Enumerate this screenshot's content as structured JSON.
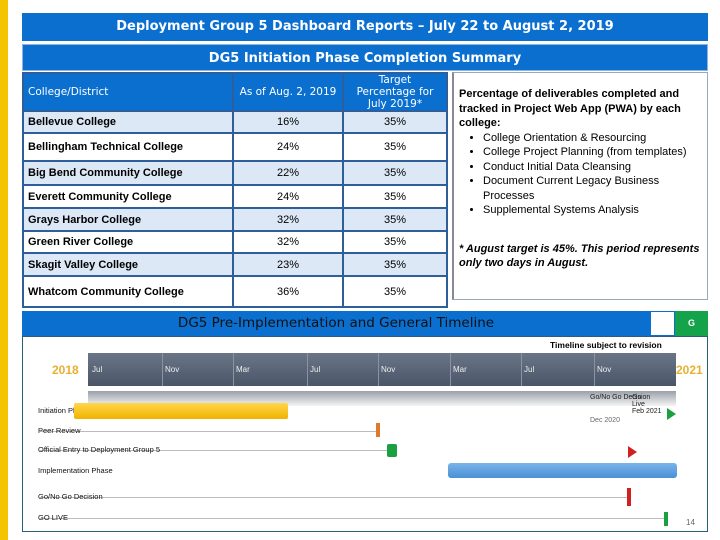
{
  "header": {
    "title": "Deployment Group 5 Dashboard Reports – July 22 to August 2,  2019",
    "subtitle": "DG5 Initiation Phase Completion Summary"
  },
  "table": {
    "columns": [
      "College/District",
      "As of Aug. 2, 2019",
      "Target Percentage for July 2019*"
    ],
    "rows": [
      {
        "college": "Bellevue College",
        "actual": "16%",
        "target": "35%"
      },
      {
        "college": "Bellingham Technical College",
        "actual": "24%",
        "target": "35%"
      },
      {
        "college": "Big Bend Community College",
        "actual": "22%",
        "target": "35%"
      },
      {
        "college": "Everett Community College",
        "actual": "24%",
        "target": "35%"
      },
      {
        "college": "Grays Harbor College",
        "actual": "32%",
        "target": "35%"
      },
      {
        "college": "Green River College",
        "actual": "32%",
        "target": "35%"
      },
      {
        "college": "Skagit Valley College",
        "actual": "23%",
        "target": "35%"
      },
      {
        "college": "Whatcom Community College",
        "actual": "36%",
        "target": "35%"
      }
    ]
  },
  "notes": {
    "intro": "Percentage of deliverables completed and tracked in Project Web App (PWA) by each college:",
    "items": [
      "College Orientation & Resourcing",
      "College Project Planning (from templates)",
      "Conduct Initial Data Cleansing",
      "Document Current Legacy Business Processes",
      "Supplemental Systems Analysis"
    ],
    "footnote": "* August target is 45%. This period represents only two days in August."
  },
  "timeline": {
    "title": "DG5 Pre-Implementation and General Timeline",
    "status": "G",
    "status_color": "#14a24a",
    "revision_note": "Timeline subject to revision",
    "start_year": "2018",
    "end_year": "2021",
    "months": [
      "Jul",
      "Nov",
      "Mar",
      "Jul",
      "Nov",
      "Mar",
      "Jul",
      "Nov"
    ],
    "rows": [
      "Initiation Phase",
      "Peer Review",
      "Official Entry to Deployment Group 5",
      "Implementation Phase",
      "Go/No Go Decision",
      "GO LIVE"
    ],
    "gonogo_label": "Go/No Go Decision",
    "gonogo_date": "Dec 2020",
    "golive_label": "Go Live",
    "golive_date": "Feb 2021"
  },
  "page_number": "14"
}
